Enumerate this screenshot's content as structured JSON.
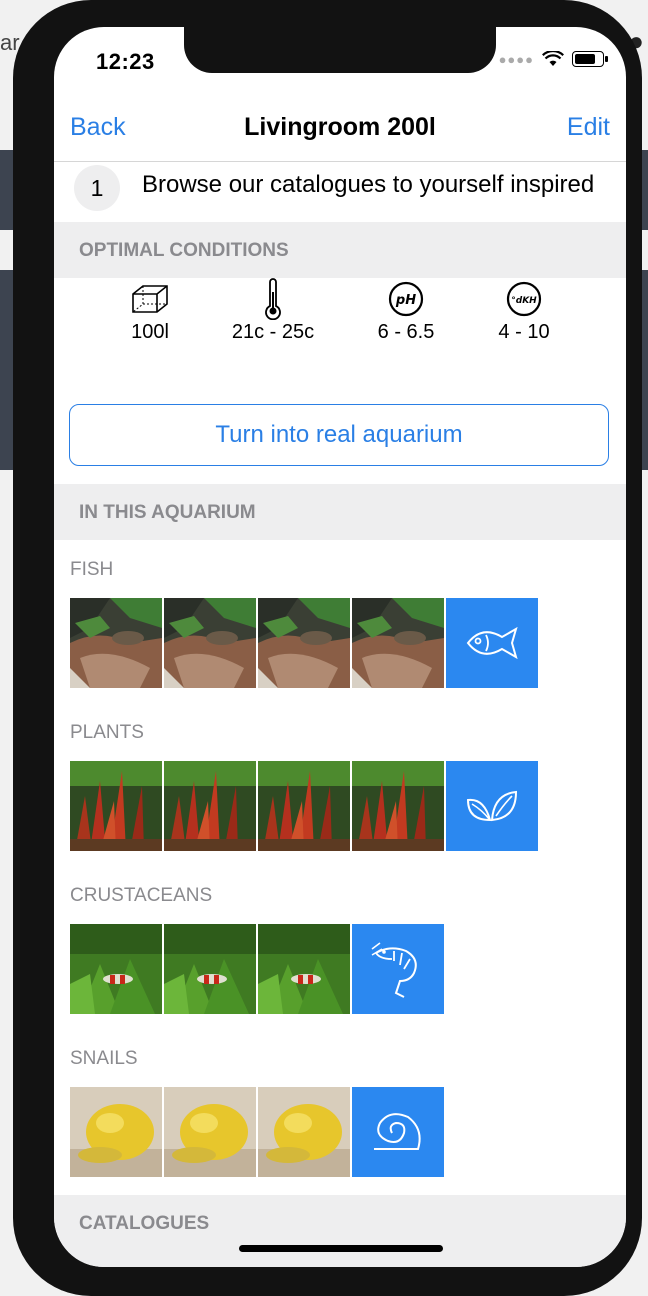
{
  "status_bar": {
    "time": "12:23"
  },
  "nav": {
    "back": "Back",
    "title": "Livingroom 200l",
    "edit": "Edit"
  },
  "step": {
    "number": "1",
    "text": "Browse our catalogues to yourself inspired"
  },
  "sections": {
    "optimal_conditions": "OPTIMAL CONDITIONS",
    "in_this_aquarium": "IN THIS AQUARIUM",
    "catalogues": "CATALOGUES"
  },
  "conditions": [
    {
      "icon": "tank-icon",
      "value": "100l"
    },
    {
      "icon": "thermometer-icon",
      "value": "21c - 25c"
    },
    {
      "icon": "ph-icon",
      "value": "6 - 6.5",
      "badge": "pH"
    },
    {
      "icon": "dkh-icon",
      "value": "4 - 10",
      "badge": "°dKH"
    }
  ],
  "turn_button": "Turn into real aquarium",
  "categories": [
    {
      "label": "FISH",
      "thumb_count": 4,
      "icon": "fish-icon"
    },
    {
      "label": "PLANTS",
      "thumb_count": 4,
      "icon": "leaf-icon"
    },
    {
      "label": "CRUSTACEANS",
      "thumb_count": 3,
      "icon": "shrimp-icon"
    },
    {
      "label": "SNAILS",
      "thumb_count": 3,
      "icon": "snail-shell-icon"
    }
  ],
  "colors": {
    "accent": "#2a7fe5",
    "tile": "#2b88f0",
    "section_bg": "#eeeeef",
    "section_text": "#8a8a8e"
  }
}
